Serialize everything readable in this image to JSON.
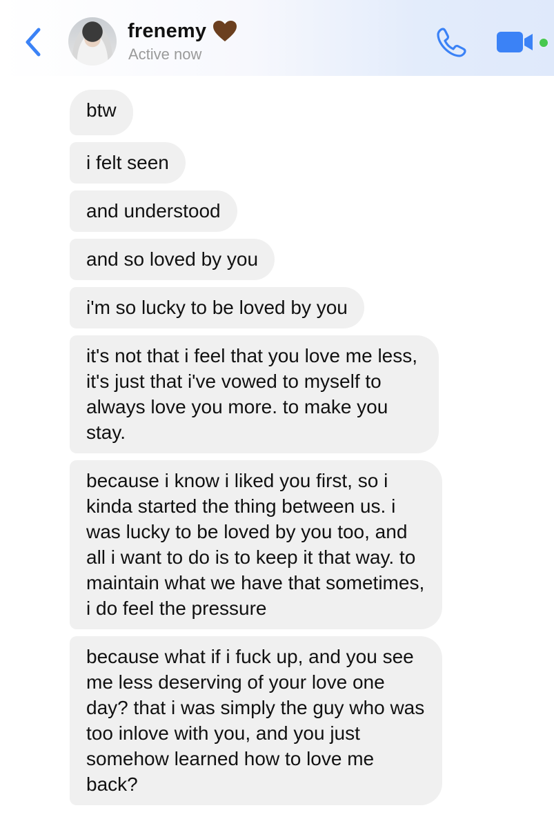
{
  "header": {
    "back_icon": "chevron-left-icon",
    "contact_name": "frenemy",
    "name_emoji": "brown-heart-icon",
    "status": "Active now",
    "call_icon": "phone-icon",
    "video_icon": "video-camera-icon",
    "online_indicator_color": "#47c84e"
  },
  "colors": {
    "accent": "#3b82f6",
    "bubble_bg": "#f0f0f0",
    "heart": "#6b3f1f"
  },
  "messages": [
    "btw",
    "i felt seen",
    "and understood",
    "and so loved by you",
    "i'm so lucky to be loved by you",
    "it's not that i feel that you love me less, it's just that i've vowed to myself to always love you more. to make you stay.",
    "because i know i liked you first, so i kinda started the thing between us. i was lucky to be loved by you too, and all i want to do is to keep it that way. to maintain what we have that sometimes, i do feel the pressure",
    "because what if i fuck up, and you see me less deserving of your love one day? that i was simply the guy who was too inlove with you, and you just somehow learned how to love me back?"
  ]
}
